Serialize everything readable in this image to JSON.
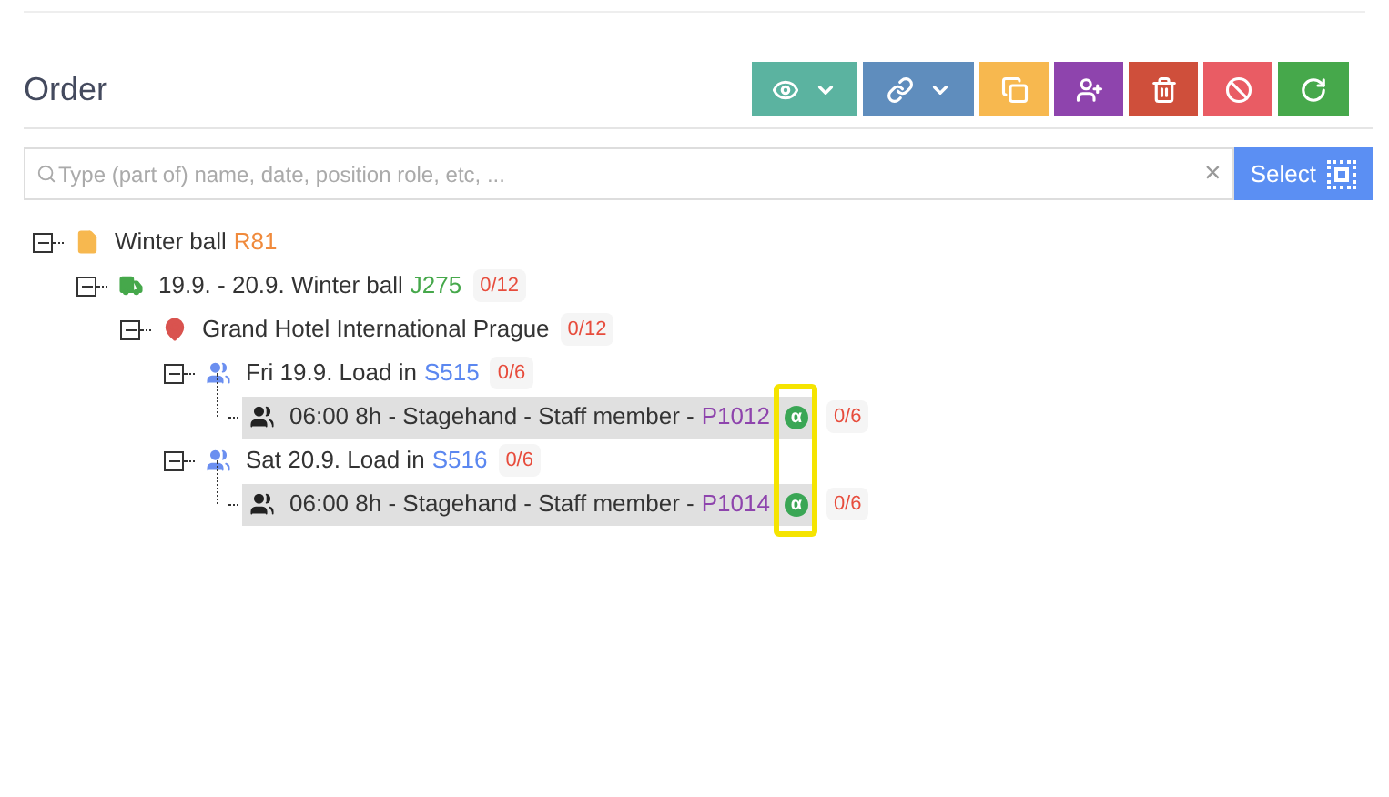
{
  "title": "Order",
  "toolbar": [
    {
      "kind": "view",
      "dropdown": true
    },
    {
      "kind": "link",
      "dropdown": true
    },
    {
      "kind": "copy",
      "dropdown": false
    },
    {
      "kind": "add-person",
      "dropdown": false
    },
    {
      "kind": "delete",
      "dropdown": false
    },
    {
      "kind": "cancel",
      "dropdown": false
    },
    {
      "kind": "refresh",
      "dropdown": false
    }
  ],
  "search": {
    "placeholder": "Type (part of) name, date, position role, etc, ...",
    "clear": "×",
    "button": "Select"
  },
  "tree": [
    {
      "kind": "order",
      "expanded": true,
      "label": "Winter ball",
      "code": "R81",
      "children": [
        {
          "kind": "job",
          "expanded": true,
          "label": "19.9. - 20.9. Winter ball",
          "code": "J275",
          "count": "0/12",
          "children": [
            {
              "kind": "location",
              "expanded": true,
              "label": "Grand Hotel International Prague",
              "count": "0/12",
              "children": [
                {
                  "kind": "shift",
                  "expanded": true,
                  "label": "Fri 19.9. Load in",
                  "code": "S515",
                  "count": "0/6",
                  "children": [
                    {
                      "kind": "position",
                      "label": "06:00 8h - Stagehand - Staff member -",
                      "code": "P1012",
                      "symbol": "α",
                      "count": "0/6"
                    }
                  ]
                },
                {
                  "kind": "shift",
                  "expanded": true,
                  "label": "Sat 20.9. Load in",
                  "code": "S516",
                  "count": "0/6",
                  "children": [
                    {
                      "kind": "position",
                      "label": "06:00 8h - Stagehand - Staff member -",
                      "code": "P1014",
                      "symbol": "α",
                      "count": "0/6"
                    }
                  ]
                }
              ]
            }
          ]
        }
      ]
    }
  ]
}
